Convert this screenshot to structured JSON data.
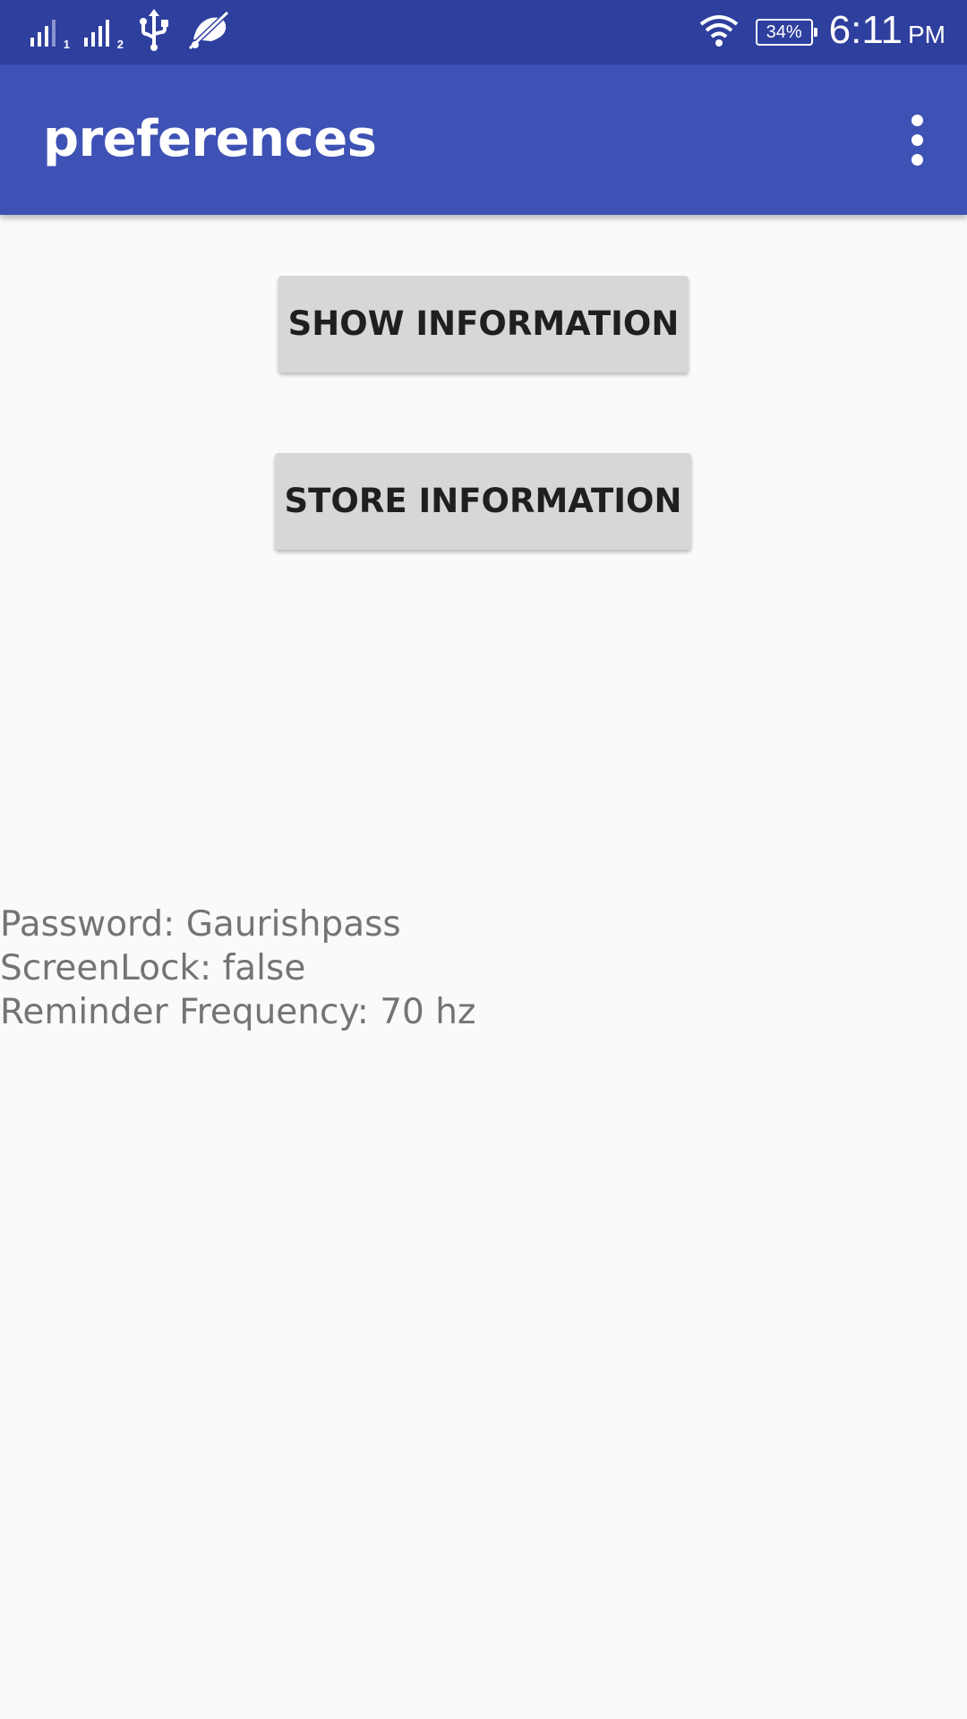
{
  "status_bar": {
    "sim1_label": "1",
    "sim2_label": "2",
    "battery_percent": "34%",
    "time": "6:11",
    "ampm": "PM",
    "icons": [
      "signal-sim1-icon",
      "signal-sim2-icon",
      "usb-icon",
      "no-notification-icon",
      "wifi-icon",
      "battery-icon"
    ]
  },
  "app_bar": {
    "title": "preferences",
    "menu_icon": "overflow-menu-icon"
  },
  "buttons": {
    "show_label": "SHOW INFORMATION",
    "store_label": "STORE INFORMATION"
  },
  "info": {
    "password": "Password: Gaurishpass",
    "screen_lock": "ScreenLock: false",
    "reminder_frequency": "Reminder Frequency: 70 hz"
  },
  "colors": {
    "status_bar": "#2f3f9e",
    "app_bar": "#3e51b5",
    "background": "#fafafa",
    "button": "#d6d7d7",
    "info_text": "#747474"
  }
}
